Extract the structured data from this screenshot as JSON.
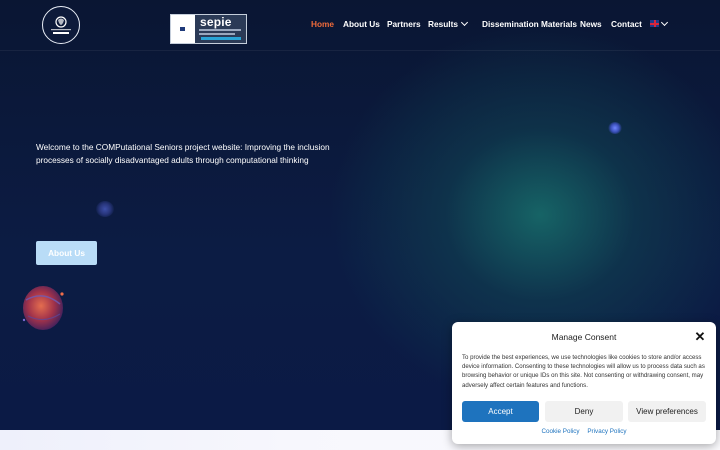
{
  "header": {
    "logo_text": "COMPUTATIONAL SENIORS",
    "partner_logo_text": "sepie",
    "nav": [
      {
        "label": "Home",
        "active": true
      },
      {
        "label": "About Us"
      },
      {
        "label": "Partners"
      },
      {
        "label": "Results",
        "has_dropdown": true
      },
      {
        "label": "Dissemination Materials"
      },
      {
        "label": "News"
      },
      {
        "label": "Contact"
      }
    ],
    "language_icon": "uk-flag-icon"
  },
  "hero": {
    "welcome_text": "Welcome to the COMPutational Seniors project website: Improving the inclusion processes of socially disadvantaged adults through computational thinking",
    "button_label": "About Us"
  },
  "consent": {
    "title": "Manage Consent",
    "body": "To provide the best experiences, we use technologies like cookies to store and/or access device information. Consenting to these technologies will allow us to process data such as browsing behavior or unique IDs on this site. Not consenting or withdrawing consent, may adversely affect certain features and functions.",
    "accept_label": "Accept",
    "deny_label": "Deny",
    "prefs_label": "View preferences",
    "cookie_policy_label": "Cookie Policy",
    "privacy_policy_label": "Privacy Policy"
  },
  "colors": {
    "background": "#0b1838",
    "active_nav": "#ee6a3a",
    "accept_button": "#1e73be",
    "about_button": "#b9dcf7"
  }
}
